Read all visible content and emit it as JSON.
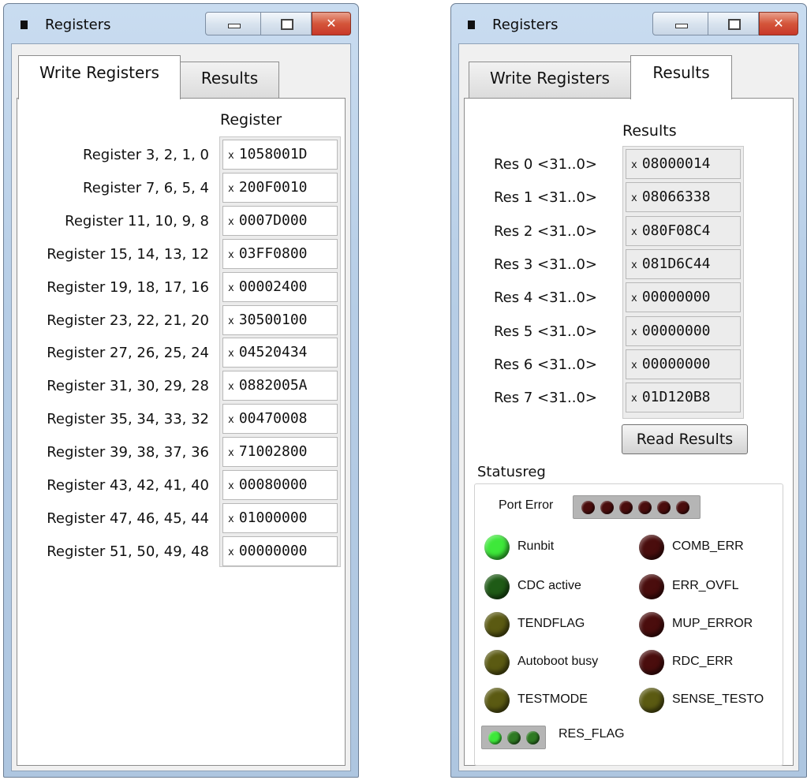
{
  "left_window": {
    "title": "Registers",
    "close_glyph": "✕",
    "tabs": [
      {
        "label": "Write Registers",
        "active": true
      },
      {
        "label": "Results",
        "active": false
      }
    ],
    "column_header": "Register",
    "value_prefix": "x",
    "rows": [
      {
        "label": "Register 3, 2, 1, 0",
        "value": "1058001D"
      },
      {
        "label": "Register 7, 6, 5, 4",
        "value": "200F0010"
      },
      {
        "label": "Register 11, 10, 9, 8",
        "value": "0007D000"
      },
      {
        "label": "Register 15, 14, 13, 12",
        "value": "03FF0800"
      },
      {
        "label": "Register 19, 18, 17, 16",
        "value": "00002400"
      },
      {
        "label": "Register 23, 22, 21, 20",
        "value": "30500100"
      },
      {
        "label": "Register 27, 26, 25, 24",
        "value": "04520434"
      },
      {
        "label": "Register 31, 30, 29, 28",
        "value": "0882005A"
      },
      {
        "label": "Register 35, 34, 33, 32",
        "value": "00470008"
      },
      {
        "label": "Register 39, 38, 37, 36",
        "value": "71002800"
      },
      {
        "label": "Register 43, 42, 41, 40",
        "value": "00080000"
      },
      {
        "label": "Register 47, 46, 45, 44",
        "value": "01000000"
      },
      {
        "label": "Register 51, 50, 49, 48",
        "value": "00000000"
      }
    ]
  },
  "right_window": {
    "title": "Registers",
    "close_glyph": "✕",
    "tabs": [
      {
        "label": "Write Registers",
        "active": false
      },
      {
        "label": "Results",
        "active": true
      }
    ],
    "column_header": "Results",
    "value_prefix": "x",
    "rows": [
      {
        "label": "Res 0 <31..0>",
        "value": "08000014"
      },
      {
        "label": "Res 1 <31..0>",
        "value": "08066338"
      },
      {
        "label": "Res 2 <31..0>",
        "value": "080F08C4"
      },
      {
        "label": "Res 3 <31..0>",
        "value": "081D6C44"
      },
      {
        "label": "Res 4 <31..0>",
        "value": "00000000"
      },
      {
        "label": "Res 5 <31..0>",
        "value": "00000000"
      },
      {
        "label": "Res 6 <31..0>",
        "value": "00000000"
      },
      {
        "label": "Res 7 <31..0>",
        "value": "01D120B8"
      }
    ],
    "read_button": "Read Results",
    "status_group": {
      "title": "Statusreg",
      "port_error_label": "Port Error",
      "port_error_led_count": 6,
      "left_indicators": [
        {
          "label": "Runbit",
          "color": "#3ee83a"
        },
        {
          "label": "CDC active",
          "color": "#1f5b16"
        },
        {
          "label": "TENDFLAG",
          "color": "#5b5a12"
        },
        {
          "label": "Autoboot busy",
          "color": "#5b5a12"
        },
        {
          "label": "TESTMODE",
          "color": "#5b5a12"
        }
      ],
      "right_indicators": [
        {
          "label": "COMB_ERR",
          "color": "#4a0d0d"
        },
        {
          "label": "ERR_OVFL",
          "color": "#4a0d0d"
        },
        {
          "label": "MUP_ERROR",
          "color": "#4a0d0d"
        },
        {
          "label": "RDC_ERR",
          "color": "#4a0d0d"
        },
        {
          "label": "SENSE_TESTO",
          "color": "#5b5a12"
        }
      ],
      "res_flag_label": "RES_FLAG",
      "res_flag_leds": [
        "#3ee83a",
        "#2e7a23",
        "#2e7a23"
      ]
    }
  },
  "colors": {
    "led_off_red": "#4a0d0d",
    "led_on_green": "#3ee83a",
    "led_dark_green": "#1f5b16",
    "led_olive": "#5b5a12"
  }
}
